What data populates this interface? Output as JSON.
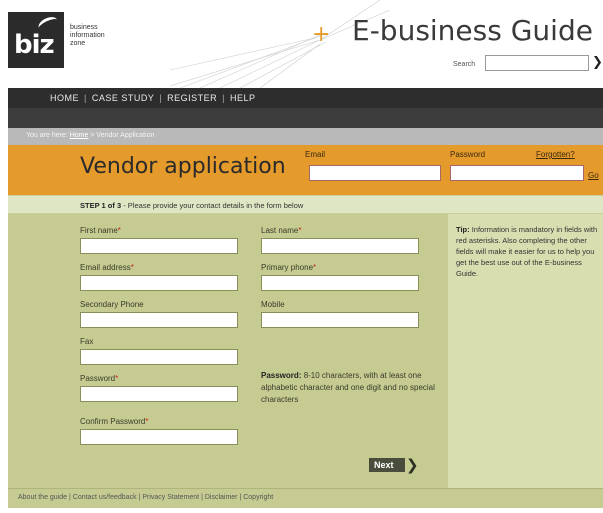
{
  "header": {
    "logo_text": "biz",
    "logo_tagline": [
      "business",
      "information",
      "zone"
    ],
    "plus": "+",
    "site_title": "E-business Guide",
    "search_label": "Search",
    "search_value": "",
    "search_go": "❯"
  },
  "nav": {
    "items": [
      "HOME",
      "CASE STUDY",
      "REGISTER",
      "HELP"
    ],
    "separator": "|"
  },
  "breadcrumb": {
    "prefix": "You are here: ",
    "home": "Home",
    "sep": " > ",
    "current": "Vendor Application"
  },
  "login": {
    "page_title": "Vendor application",
    "email_label": "Email",
    "password_label": "Password",
    "forgotten_label": "Forgotten?",
    "go_label": "Go",
    "email_value": "",
    "password_value": ""
  },
  "step": {
    "bold": "STEP 1 of 3",
    "text": " - Please provide your contact details in the form below"
  },
  "form": {
    "first_name": "First name",
    "last_name": "Last name",
    "email": "Email address",
    "primary_phone": "Primary phone",
    "secondary_phone": "Secondary Phone",
    "mobile": "Mobile",
    "fax": "Fax",
    "password": "Password",
    "confirm_password": "Confirm Password",
    "required_mark": "*",
    "password_note_bold": "Password:",
    "password_note_text": " 8-10 characters, with at least one alphabetic character and one digit and no special characters",
    "next_label": "Next",
    "next_chevron": "❯"
  },
  "tip": {
    "bold": "Tip:",
    "text": " Information is mandatory in fields with red asterisks. Also completing the other fields will make it easier for us to help you get the best use out of the E-business Guide."
  },
  "footer": {
    "links": [
      "About the guide",
      "Contact us/feedback",
      "Privacy Statement",
      "Disclaimer",
      "Copyright"
    ],
    "separator": " | "
  },
  "colors": {
    "orange": "#e59a2c",
    "form_green": "#c6cc91",
    "tip_green": "#d9deb0",
    "nav_dark": "#2d2d2d",
    "required_red": "#c0271b"
  }
}
